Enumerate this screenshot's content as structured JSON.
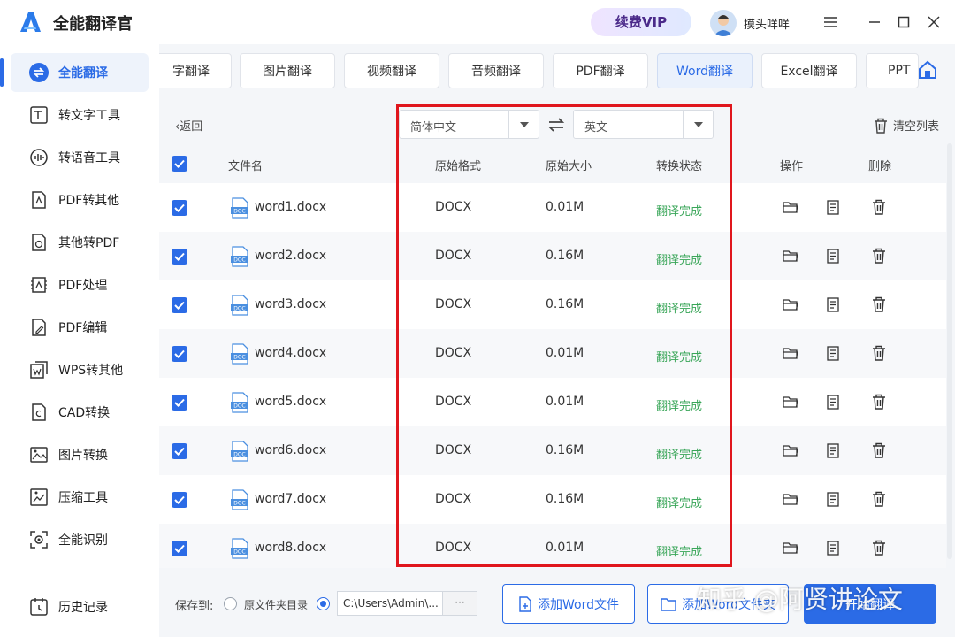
{
  "app": {
    "title": "全能翻译官",
    "vip_label": "续费VIP",
    "username": "摸头咩咩"
  },
  "sidebar": {
    "items": [
      {
        "label": "全能翻译",
        "icon": "translate-icon",
        "active": true
      },
      {
        "label": "转文字工具",
        "icon": "text-convert-icon"
      },
      {
        "label": "转语音工具",
        "icon": "voice-icon"
      },
      {
        "label": "PDF转其他",
        "icon": "pdf-convert-icon"
      },
      {
        "label": "其他转PDF",
        "icon": "to-pdf-icon"
      },
      {
        "label": "PDF处理",
        "icon": "pdf-process-icon"
      },
      {
        "label": "PDF编辑",
        "icon": "pdf-edit-icon"
      },
      {
        "label": "WPS转其他",
        "icon": "wps-icon"
      },
      {
        "label": "CAD转换",
        "icon": "cad-icon"
      },
      {
        "label": "图片转换",
        "icon": "image-convert-icon"
      },
      {
        "label": "压缩工具",
        "icon": "compress-icon"
      },
      {
        "label": "全能识别",
        "icon": "recognize-icon"
      },
      {
        "label": "历史记录",
        "icon": "history-icon"
      }
    ]
  },
  "tabs": [
    {
      "label": "字翻译"
    },
    {
      "label": "图片翻译"
    },
    {
      "label": "视频翻译"
    },
    {
      "label": "音频翻译"
    },
    {
      "label": "PDF翻译"
    },
    {
      "label": "Word翻译",
      "active": true
    },
    {
      "label": "Excel翻译"
    },
    {
      "label": "PPT"
    }
  ],
  "toolbar": {
    "back_label": "返回",
    "source_lang": "简体中文",
    "target_lang": "英文",
    "clear_label": "清空列表"
  },
  "table": {
    "headers": {
      "filename": "文件名",
      "format": "原始格式",
      "size": "原始大小",
      "status": "转换状态",
      "actions": "操作",
      "delete": "删除"
    },
    "rows": [
      {
        "name": "word1.docx",
        "format": "DOCX",
        "size": "0.01M",
        "status": "翻译完成"
      },
      {
        "name": "word2.docx",
        "format": "DOCX",
        "size": "0.16M",
        "status": "翻译完成"
      },
      {
        "name": "word3.docx",
        "format": "DOCX",
        "size": "0.16M",
        "status": "翻译完成"
      },
      {
        "name": "word4.docx",
        "format": "DOCX",
        "size": "0.01M",
        "status": "翻译完成"
      },
      {
        "name": "word5.docx",
        "format": "DOCX",
        "size": "0.01M",
        "status": "翻译完成"
      },
      {
        "name": "word6.docx",
        "format": "DOCX",
        "size": "0.16M",
        "status": "翻译完成"
      },
      {
        "name": "word7.docx",
        "format": "DOCX",
        "size": "0.16M",
        "status": "翻译完成"
      },
      {
        "name": "word8.docx",
        "format": "DOCX",
        "size": "0.01M",
        "status": "翻译完成"
      }
    ]
  },
  "bottom": {
    "save_to_label": "保存到:",
    "option_original": "原文件夹目录",
    "path_value": "C:\\Users\\Admin\\...",
    "more_label": "···",
    "add_file_label": "添加Word文件",
    "add_folder_label": "添加Word文件夹",
    "start_label": "开始翻译"
  },
  "watermark": "知乎 @阿贤讲论文",
  "colors": {
    "accent": "#2b6be6",
    "success": "#3aa659",
    "highlight": "#e0161d"
  }
}
